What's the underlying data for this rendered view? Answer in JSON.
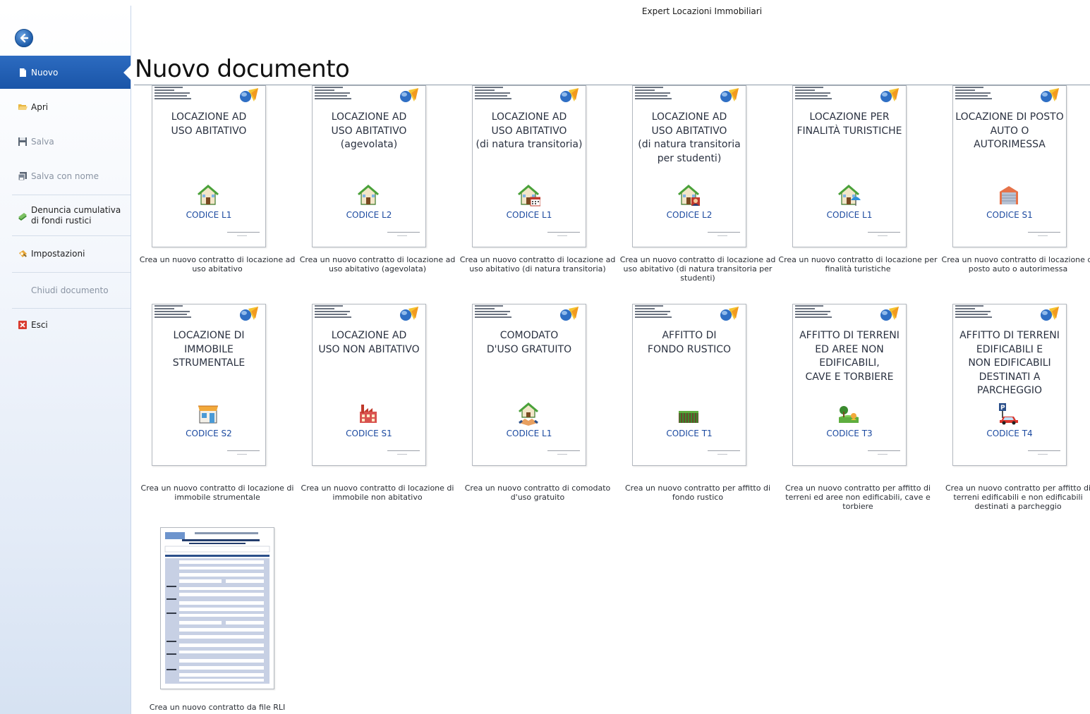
{
  "app": {
    "title": "Expert Locazioni Immobiliari"
  },
  "sidebar": {
    "items": [
      {
        "label": "Nuovo",
        "state": "active",
        "icon": "new-document-icon"
      },
      {
        "label": "Apri",
        "state": "normal",
        "icon": "folder-open-icon"
      },
      {
        "label": "Salva",
        "state": "disabled",
        "icon": "floppy-disk-icon"
      },
      {
        "label": "Salva con nome",
        "state": "disabled",
        "icon": "save-as-icon"
      },
      {
        "label": "Denuncia cumulativa\ndi fondi rustici",
        "state": "normal",
        "icon": "money-stack-icon"
      },
      {
        "label": "Impostazioni",
        "state": "normal",
        "icon": "settings-icon"
      },
      {
        "label": "Chiudi documento",
        "state": "disabled",
        "icon": ""
      },
      {
        "label": "Esci",
        "state": "normal",
        "icon": "exit-icon"
      }
    ]
  },
  "main": {
    "title": "Nuovo documento",
    "templates": [
      {
        "title": "LOCAZIONE AD\nUSO ABITATIVO",
        "code": "CODICE L1",
        "icon": "house-icon",
        "description": "Crea un nuovo contratto di locazione ad uso abitativo"
      },
      {
        "title": "LOCAZIONE AD\nUSO ABITATIVO\n(agevolata)",
        "code": "CODICE L2",
        "icon": "house-icon",
        "description": "Crea un nuovo contratto di locazione ad uso abitativo (agevolata)"
      },
      {
        "title": "LOCAZIONE AD\nUSO ABITATIVO\n(di natura transitoria)",
        "code": "CODICE L1",
        "icon": "house-calendar-icon",
        "description": "Crea un nuovo contratto di locazione ad uso abitativo (di natura transitoria)"
      },
      {
        "title": "LOCAZIONE AD\nUSO ABITATIVO\n(di natura transitoria\nper studenti)",
        "code": "CODICE L2",
        "icon": "house-student-icon",
        "description": "Crea un nuovo contratto di locazione ad uso abitativo (di natura transitoria per studenti)"
      },
      {
        "title": "LOCAZIONE PER\nFINALITÀ TURISTICHE",
        "code": "CODICE L1",
        "icon": "house-umbrella-icon",
        "description": "Crea un nuovo contratto di locazione per finalità turistiche"
      },
      {
        "title": "LOCAZIONE DI POSTO\nAUTO O AUTORIMESSA",
        "code": "CODICE S1",
        "icon": "garage-icon",
        "description": "Crea un nuovo contratto di locazione di posto auto o autorimessa"
      },
      {
        "title": "LOCAZIONE DI\nIMMOBILE\nSTRUMENTALE",
        "code": "CODICE S2",
        "icon": "shop-icon",
        "description": "Crea un nuovo contratto di locazione di immobile strumentale"
      },
      {
        "title": "LOCAZIONE AD\nUSO NON ABITATIVO",
        "code": "CODICE S1",
        "icon": "factory-icon",
        "description": "Crea un nuovo contratto di locazione di immobile non abitativo"
      },
      {
        "title": "COMODATO\nD'USO GRATUITO",
        "code": "CODICE L1",
        "icon": "house-handshake-icon",
        "description": "Crea un nuovo contratto di comodato d'uso gratuito"
      },
      {
        "title": "AFFITTO DI\nFONDO RUSTICO",
        "code": "CODICE T1",
        "icon": "field-icon",
        "description": "Crea un nuovo contratto per affitto di fondo rustico"
      },
      {
        "title": "AFFITTO DI TERRENI\nED AREE NON\nEDIFICABILI,\nCAVE E TORBIERE",
        "code": "CODICE T3",
        "icon": "landscape-icon",
        "description": "Crea un nuovo contratto per affitto di terreni ed aree non edificabili, cave e torbiere"
      },
      {
        "title": "AFFITTO DI TERRENI\nEDIFICABILI E\nNON EDIFICABILI\nDESTINATI A\nPARCHEGGIO",
        "code": "CODICE T4",
        "icon": "parking-car-icon",
        "description": "Crea un nuovo contratto per affitto di terreni edificabili e non edificabili destinati a parcheggio"
      }
    ],
    "rli": {
      "description": "Crea un nuovo contratto da file RLI",
      "icon": "rli-form-thumbnail"
    }
  }
}
